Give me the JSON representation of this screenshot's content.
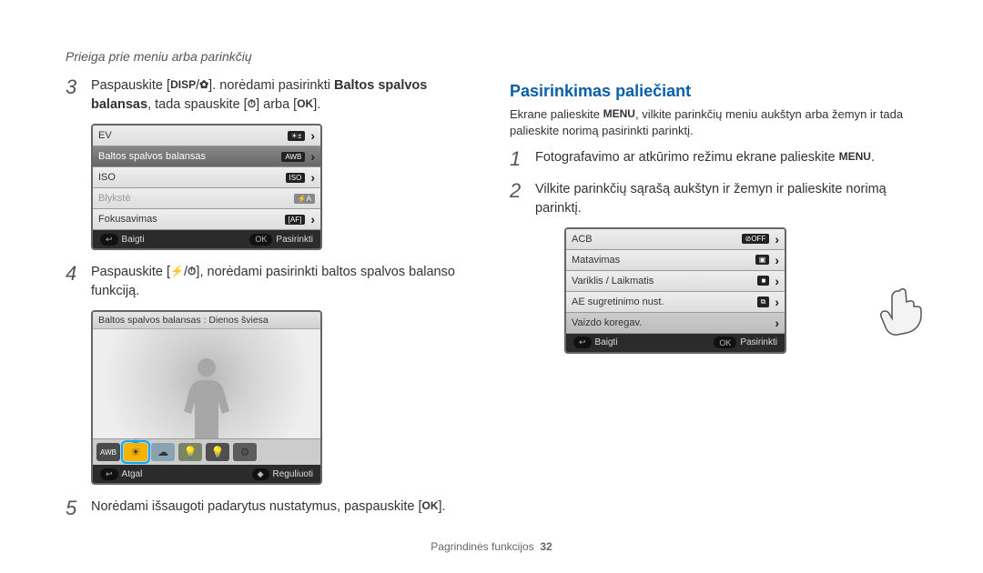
{
  "page_header": "Prieiga prie meniu arba parinkčių",
  "footer": {
    "label": "Pagrindinės funkcijos",
    "page": "32"
  },
  "left": {
    "step3": {
      "num": "3",
      "a": "Paspauskite [",
      "icon1": "DISP",
      "b": "/",
      "icon2": "✿",
      "c": "]. norėdami pasirinkti ",
      "bold": "Baltos spalvos balansas",
      "d": ", tada spauskite [",
      "icon3": "⏱",
      "e": "] arba [",
      "icon4": "OK",
      "f": "]."
    },
    "screen1": {
      "rows": [
        {
          "label": "EV",
          "sym": "☀±",
          "sel": false
        },
        {
          "label": "Baltos spalvos balansas",
          "sym": "AWB",
          "sel": true
        },
        {
          "label": "ISO",
          "sym": "ISO",
          "sel": false
        },
        {
          "label": "Blykstė",
          "sym": "⚡A",
          "sel": false,
          "dis": true
        },
        {
          "label": "Fokusavimas",
          "sym": "[AF]",
          "sel": false
        }
      ],
      "bar": {
        "left_pill": "↩",
        "left": "Baigti",
        "right_pill": "OK",
        "right": "Pasirinkti"
      }
    },
    "step4": {
      "num": "4",
      "a": "Paspauskite [",
      "icon1": "⚡",
      "b": "/",
      "icon2": "⏱",
      "c": "], norėdami pasirinkti baltos spalvos balanso funkciją."
    },
    "screen2": {
      "title": "Baltos spalvos balansas : Dienos šviesa",
      "swatches": [
        "AWB",
        "☀",
        "☁",
        "💡",
        "💡",
        "⚙"
      ],
      "bar": {
        "left_pill": "↩",
        "left": "Atgal",
        "right_pill": "◆",
        "right": "Reguliuoti"
      }
    },
    "step5": {
      "num": "5",
      "a": "Norėdami išsaugoti padarytus nustatymus, paspauskite [",
      "icon": "OK",
      "b": "]."
    }
  },
  "right": {
    "title": "Pasirinkimas paliečiant",
    "intro_a": "Ekrane palieskite ",
    "intro_icon": "MENU",
    "intro_b": ", vilkite parinkčių meniu aukštyn arba žemyn ir tada palieskite norimą pasirinkti parinktį.",
    "step1": {
      "num": "1",
      "a": "Fotografavimo ar atkūrimo režimu ekrane palieskite ",
      "icon": "MENU",
      "b": "."
    },
    "step2": {
      "num": "2",
      "text": "Vilkite parinkčių sąrašą aukštyn ir žemyn ir palieskite norimą parinktį."
    },
    "screen": {
      "rows": [
        {
          "label": "ACB",
          "sym": "⊘OFF"
        },
        {
          "label": "Matavimas",
          "sym": "▣"
        },
        {
          "label": "Variklis / Laikmatis",
          "sym": "■"
        },
        {
          "label": "AE sugretinimo nust.",
          "sym": "⧉"
        },
        {
          "label": "Vaizdo koregav.",
          "sym": ""
        }
      ],
      "bar": {
        "left_pill": "↩",
        "left": "Baigti",
        "right_pill": "OK",
        "right": "Pasirinkti"
      }
    }
  }
}
